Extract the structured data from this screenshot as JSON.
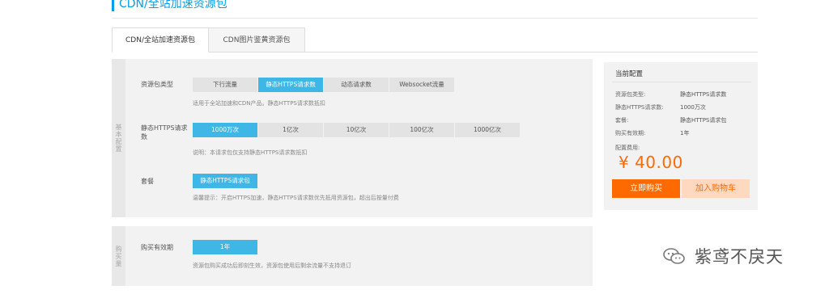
{
  "page_title": "CDN/全站加速资源包",
  "tabs": [
    {
      "label": "CDN/全站加速资源包",
      "active": true
    },
    {
      "label": "CDN图片鉴黄资源包",
      "active": false
    }
  ],
  "section1": {
    "side_label": "基本配置",
    "package_type": {
      "label": "资源包类型",
      "options": [
        "下行流量",
        "静态HTTPS请求数",
        "动态请求数",
        "Websocket流量"
      ],
      "selected": "静态HTTPS请求数",
      "hint": "适用于全站加速和CDN产品。静态HTTPS请求数抵扣"
    },
    "request_count": {
      "label": "静态HTTPS请求数",
      "options": [
        "1000万次",
        "1亿次",
        "10亿次",
        "100亿次",
        "1000亿次"
      ],
      "selected": "1000万次",
      "hint": "说明：本请求包仅支持静态HTTPS请求数抵扣"
    },
    "plan": {
      "label": "套餐",
      "options": [
        "静态HTTPS请求包"
      ],
      "selected": "静态HTTPS请求包",
      "hint": "温馨提示：开启HTTPS加速，静态HTTPS请求数优先抵用资源包，超出后按量付费"
    }
  },
  "section2": {
    "side_label": "购买量",
    "duration": {
      "label": "购买有效期",
      "options": [
        "1年"
      ],
      "selected": "1年",
      "hint": "资源包购买成功后即刻生效，资源包使用后剩余流量不支持退订"
    }
  },
  "config": {
    "title": "当前配置",
    "rows": [
      {
        "key": "资源包类型:",
        "value": "静态HTTPS请求数"
      },
      {
        "key": "静态HTTPS请求数:",
        "value": "1000万次"
      },
      {
        "key": "套餐:",
        "value": "静态HTTPS请求包"
      },
      {
        "key": "购买有效期:",
        "value": "1年"
      }
    ],
    "fee_label": "配置费用:",
    "price": "¥ 40.00",
    "buy_label": "立即购买",
    "cart_label": "加入购物车"
  },
  "watermark": {
    "text": "紫鸢不戾天"
  },
  "colors": {
    "accent": "#3fb7e6",
    "orange": "#ff6a00",
    "cart_bg": "#ffd8c0",
    "panel_bg": "#f2f2f2"
  }
}
